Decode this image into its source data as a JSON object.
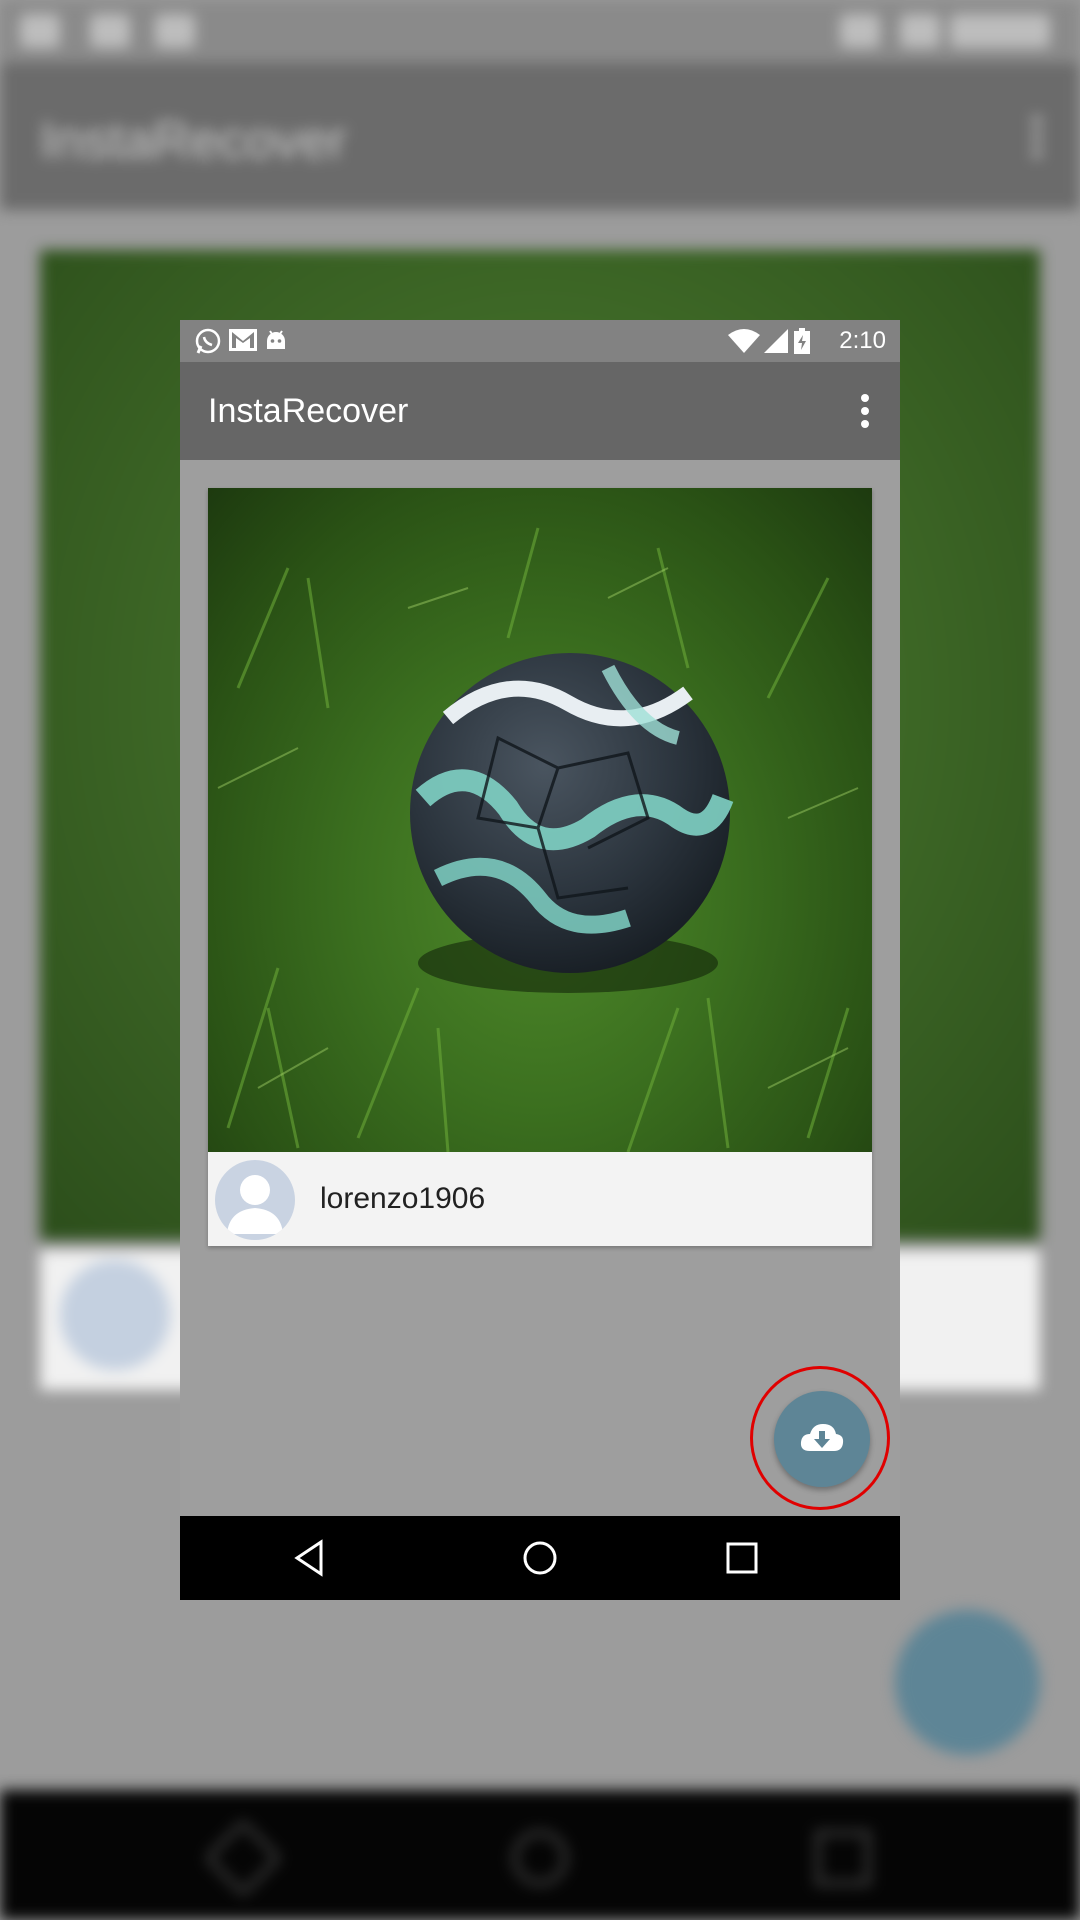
{
  "background": {
    "app_title": "InstaRecover"
  },
  "status_bar": {
    "time": "2:10",
    "notification_icons": [
      "whatsapp-icon",
      "gmail-icon",
      "android-icon"
    ],
    "system_icons": [
      "wifi-icon",
      "cellular-signal-icon",
      "battery-charging-icon"
    ]
  },
  "app_bar": {
    "title": "InstaRecover",
    "menu_icon": "more-vert-icon"
  },
  "post": {
    "image_description": "soccer-ball-on-grass",
    "username": "lorenzo1906",
    "avatar_icon": "default-avatar-icon"
  },
  "fab": {
    "icon": "cloud-download-icon"
  },
  "nav_bar": {
    "buttons": [
      "back-icon",
      "home-icon",
      "recents-icon"
    ]
  },
  "colors": {
    "app_bar": "#666666",
    "status_bar": "#828282",
    "fab": "#5e8596",
    "highlight": "#e00000",
    "nav_bar": "#000000"
  }
}
